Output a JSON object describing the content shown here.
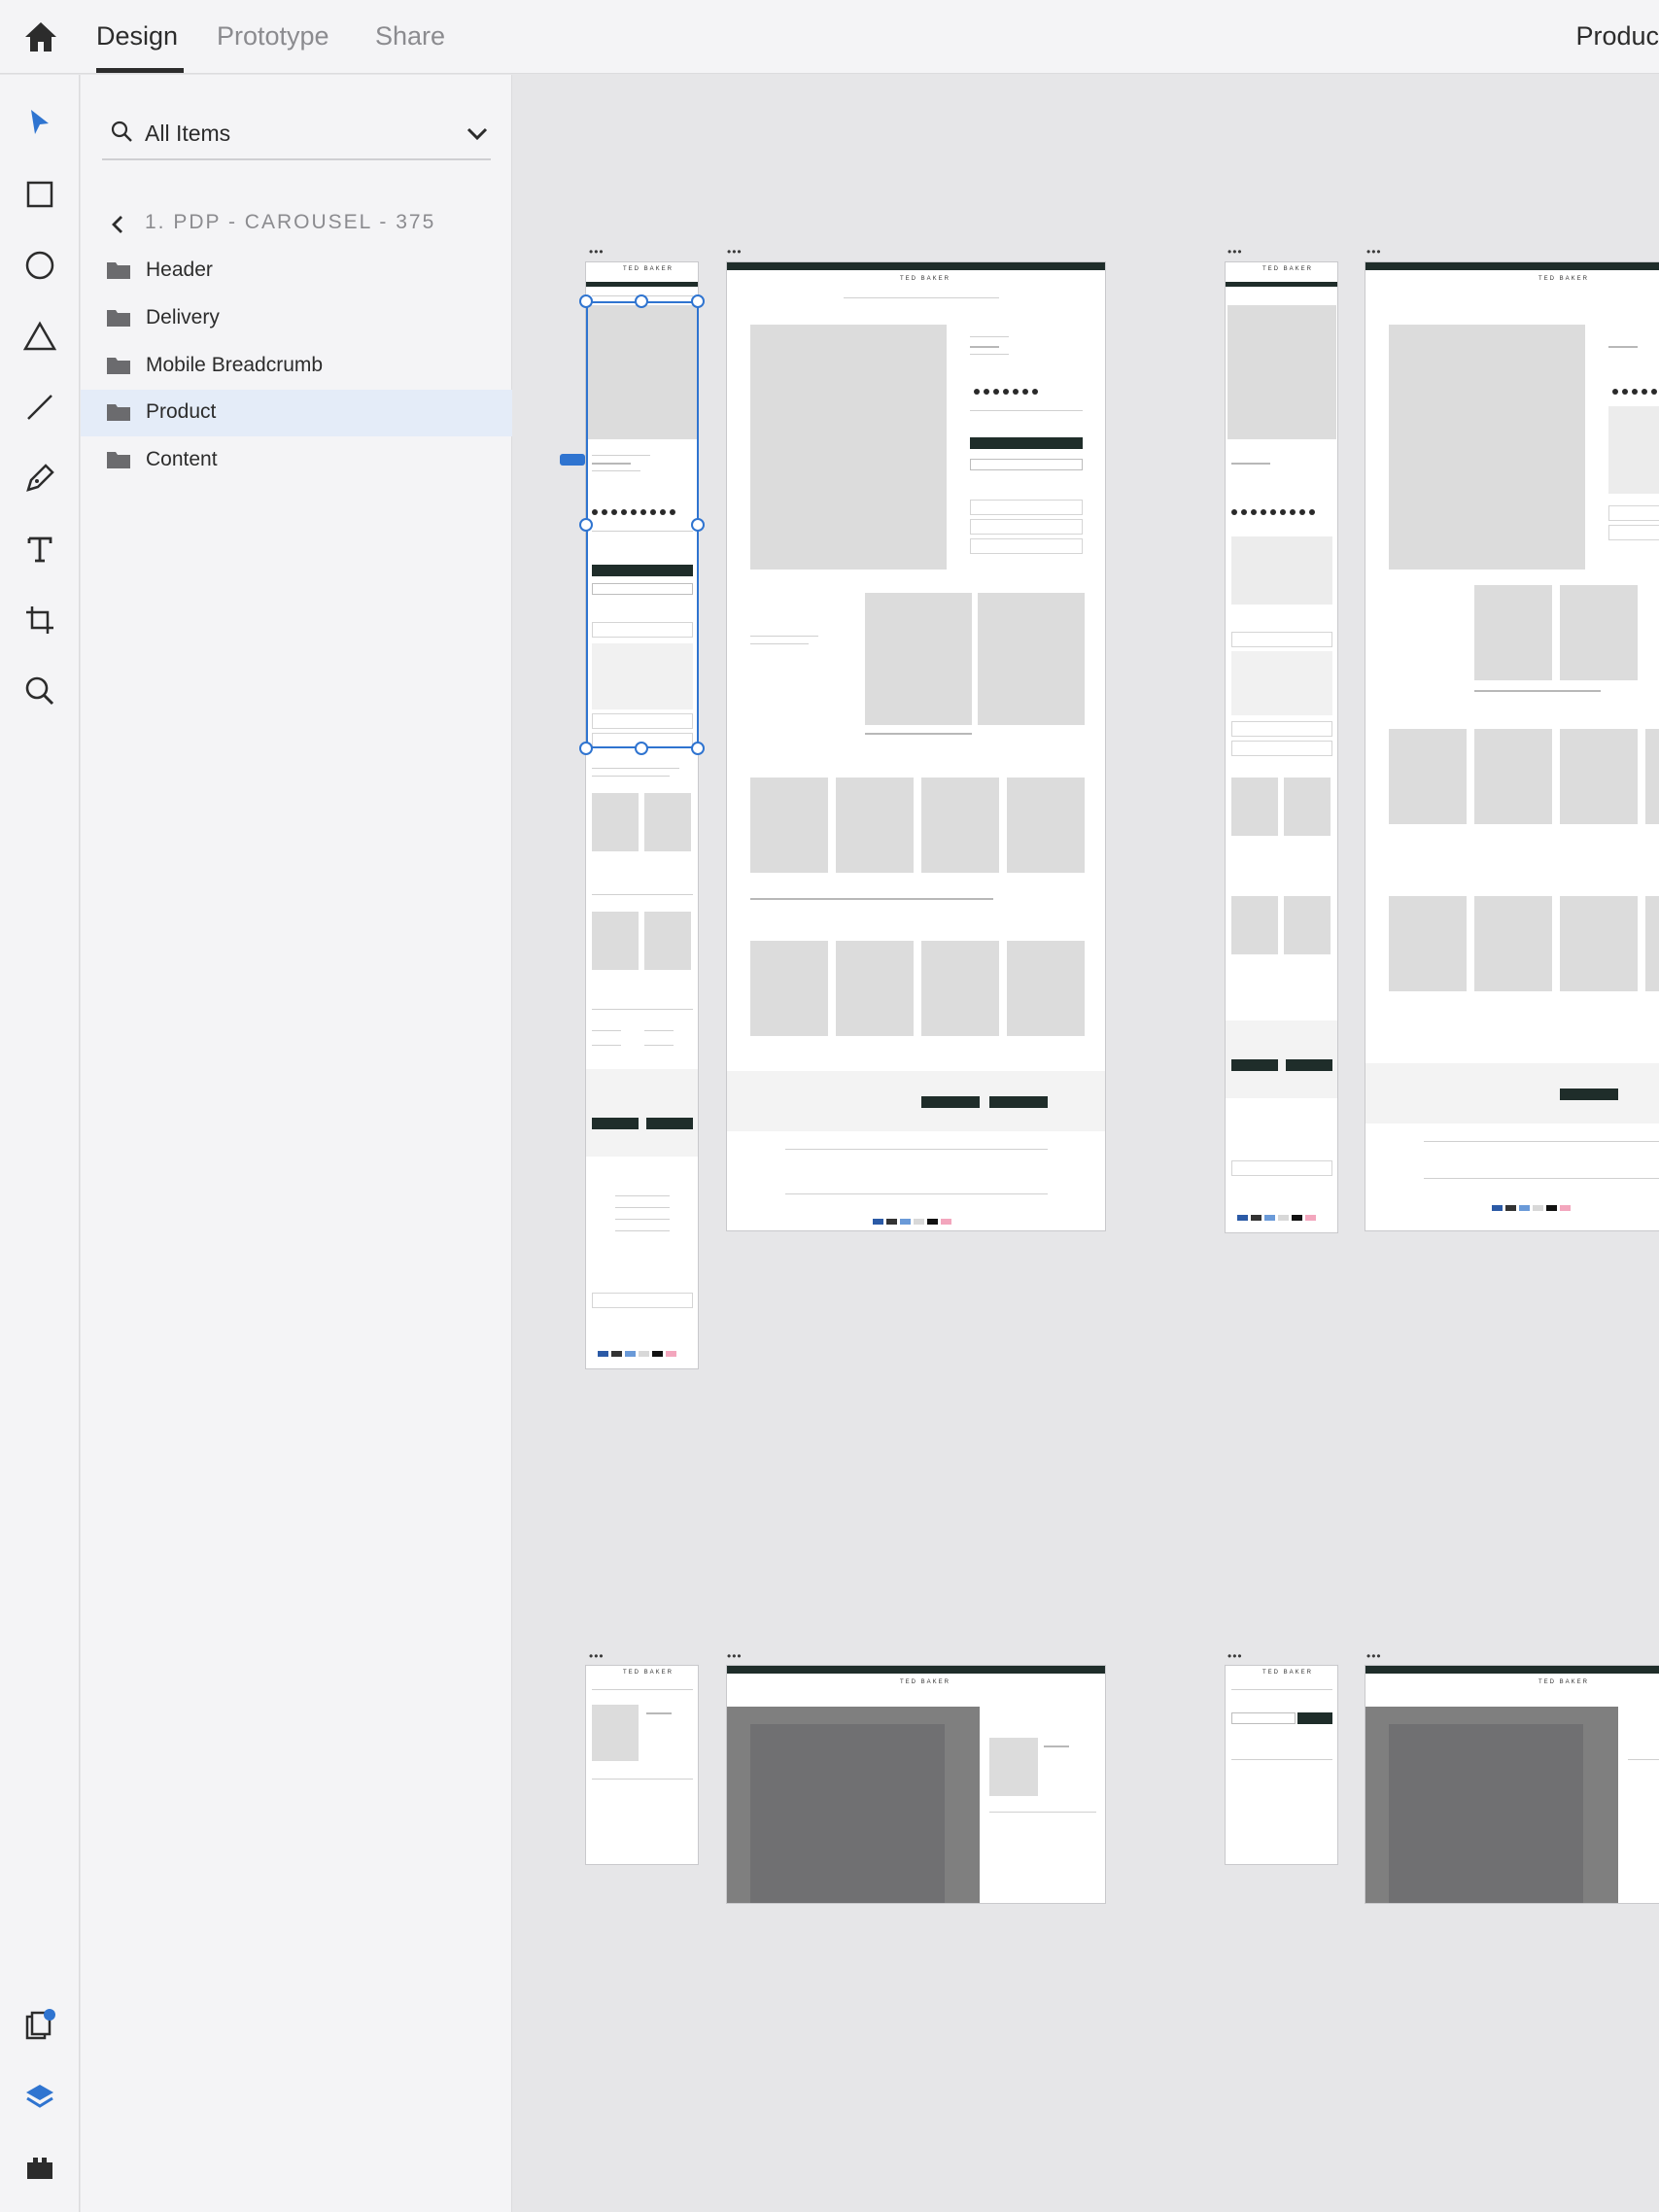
{
  "app": {
    "tabs": [
      {
        "label": "Design",
        "active": true
      },
      {
        "label": "Prototype",
        "active": false
      },
      {
        "label": "Share",
        "active": false
      }
    ],
    "document_title": "Produc"
  },
  "toolbar": {
    "tools": [
      "select-icon",
      "rectangle-icon",
      "ellipse-icon",
      "polygon-icon",
      "line-icon",
      "pen-icon",
      "text-icon",
      "artboard-icon",
      "zoom-icon"
    ],
    "bottom": [
      "assets-icon",
      "layers-icon",
      "plugins-icon"
    ]
  },
  "layers_panel": {
    "search": {
      "placeholder": "All Items",
      "value": ""
    },
    "breadcrumb": "1. PDP - CAROUSEL - 375",
    "items": [
      {
        "name": "Header",
        "selected": false
      },
      {
        "name": "Delivery",
        "selected": false
      },
      {
        "name": "Mobile Breadcrumb",
        "selected": false
      },
      {
        "name": "Product",
        "selected": true
      },
      {
        "name": "Content",
        "selected": false
      }
    ]
  },
  "canvas": {
    "artboard_menu": "•••",
    "brand": "TED BAKER",
    "accent": "#1f2d2a",
    "selection_color": "#2f74d0"
  }
}
